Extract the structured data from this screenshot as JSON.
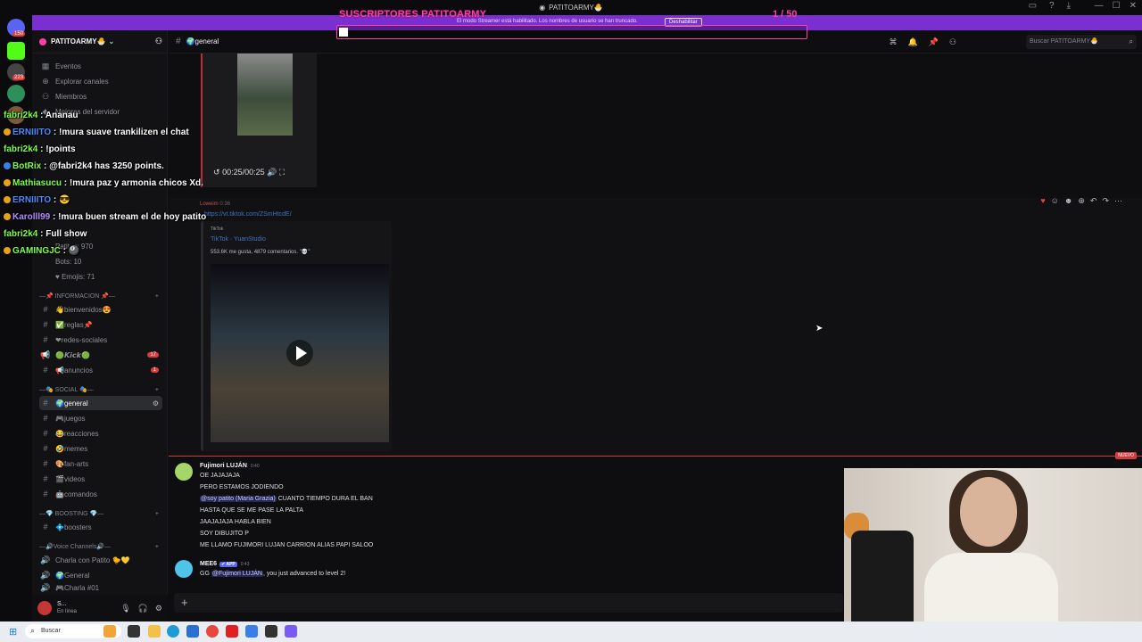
{
  "window": {
    "title": "PATITOARMY🐣"
  },
  "banner": {
    "text": "El modo Streamer está habilitado. Los nombres de usuario se han truncado.",
    "button": "Deshabilitar"
  },
  "subs_overlay": {
    "title": "SUSCRIPTORES PATITOARMY",
    "count": "1 / 50",
    "progress_fraction": 0.02
  },
  "rail": {
    "badges": [
      "150",
      "223"
    ]
  },
  "server": {
    "name": "PATITOARMY🐣"
  },
  "sidebar": {
    "top_items": [
      {
        "icon": "calendar-icon",
        "label": "Eventos"
      },
      {
        "icon": "compass-icon",
        "label": "Explorar canales"
      },
      {
        "icon": "members-icon",
        "label": "Miembros"
      },
      {
        "icon": "boost-icon",
        "label": "Mejoras del servidor"
      }
    ],
    "stats": [
      "Patitos: 970",
      "Bots: 10",
      "♥ Emojis: 71"
    ],
    "categories": [
      {
        "label": "—📌 INFORMACION 📌—",
        "channels": [
          {
            "label": "👋bienvenidos😍",
            "icon": "text-channel-icon"
          },
          {
            "label": "✅reglas📌",
            "icon": "text-channel-icon"
          },
          {
            "label": "❤redes-sociales",
            "icon": "text-channel-icon"
          },
          {
            "label": "🟢𝙆𝙞𝙘𝙠🟢",
            "icon": "announcement-icon",
            "badge": "17"
          },
          {
            "label": "📢anuncios",
            "icon": "text-channel-icon",
            "badge": "1"
          }
        ]
      },
      {
        "label": "—🎭 SOCIAL 🎭—",
        "channels": [
          {
            "label": "🌍general",
            "icon": "text-channel-icon",
            "active": true
          },
          {
            "label": "🎮juegos",
            "icon": "text-channel-icon"
          },
          {
            "label": "😂reacciones",
            "icon": "text-channel-icon"
          },
          {
            "label": "🤣memes",
            "icon": "text-channel-icon"
          },
          {
            "label": "🎨fan-arts",
            "icon": "text-channel-icon"
          },
          {
            "label": "🎬videos",
            "icon": "text-channel-icon"
          },
          {
            "label": "🤖comandos",
            "icon": "text-channel-icon"
          }
        ]
      },
      {
        "label": "—💎 BOOSTING 💎—",
        "channels": [
          {
            "label": "💠boosters",
            "icon": "text-channel-icon"
          }
        ]
      },
      {
        "label": "—🔊Voice Channels🔊—",
        "channels": [
          {
            "label": "Charla con Patito 🐤💛",
            "icon": "voice-icon"
          },
          {
            "label": "🌍General",
            "icon": "voice-icon"
          },
          {
            "label": "🎮Charla #01",
            "icon": "voice-icon"
          }
        ]
      }
    ]
  },
  "user_panel": {
    "name": "S...",
    "status": "En línea"
  },
  "channel": {
    "name": "🌍general",
    "search_placeholder": "Buscar PATITOARMY🐣"
  },
  "messages": {
    "media1_time": "00:25/00:25",
    "msg2_author": "Loweim",
    "msg2_time": "0:36",
    "msg2_link": "https://vt.tiktok.com/ZSmHtcdE/",
    "embed": {
      "provider": "TikTok",
      "title": "TikTok · YuanStudio",
      "desc": "553.6K me gusta, 4879 comentarios. \"💀\""
    },
    "new_tag": "NUEVO",
    "fujimori": {
      "author": "Fujimori LUJÁN",
      "time": "0:40",
      "lines": [
        "OE JAJAJAJA",
        "PERO ESTAMOS JODIENDO",
        "CUANTO TIEMPO DURA EL BAN",
        "HASTA QUE SE ME PASE LA PALTA",
        "JAAJAJAJA HABLA BIEN",
        "SOY DIBUJITO P",
        "ME LLAMO FUJIMORI LUJAN CARRION ALIAS PAPI SALOO"
      ],
      "mention": "@soy patito (Maria Grazia)"
    },
    "mee6": {
      "author": "MEE6",
      "tag": "✔ APP",
      "time": "0:43",
      "prefix": "GG ",
      "mention": "@Fujimori LUJÁN",
      "text": ", you just advanced to level 2!"
    }
  },
  "overlay_chat": [
    {
      "user": "fabri2k4",
      "text": " : Ananau",
      "color": "#7dff4f"
    },
    {
      "user": "ERNIIITO",
      "text": " : !mura suave trankilizen el chat",
      "color": "#4a8cff"
    },
    {
      "user": "fabri2k4",
      "text": " : !points",
      "color": "#7dff4f"
    },
    {
      "user": "BotRix",
      "text": " : @fabri2k4 has 3250 points.",
      "color": "#7dff4f"
    },
    {
      "user": "Mathiasucu",
      "text": " : !mura paz y armonia chicos Xd.",
      "color": "#7dff4f"
    },
    {
      "user": "ERNIIITO",
      "text": " : 😎",
      "color": "#4a8cff"
    },
    {
      "user": "Karolll99",
      "text": " : !mura buen stream el de hoy patito",
      "color": "#b38cff"
    },
    {
      "user": "fabri2k4",
      "text": " : Full show",
      "color": "#7dff4f"
    },
    {
      "user": "GAMINGJC",
      "text": " : 🎱",
      "color": "#7dff4f"
    }
  ],
  "taskbar": {
    "search": "Buscar"
  }
}
